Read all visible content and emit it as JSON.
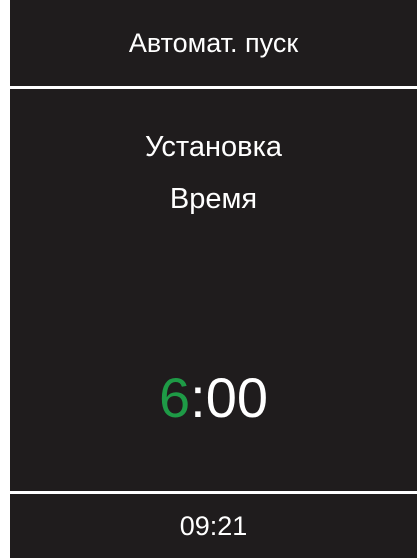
{
  "header": {
    "title": "Автомат. пуск"
  },
  "main": {
    "subtitle_line1": "Установка",
    "subtitle_line2": "Время",
    "time_value": {
      "hour": "6",
      "rest": ":00"
    }
  },
  "footer": {
    "clock": "09:21"
  },
  "colors": {
    "background": "#1f1c1d",
    "text": "#ffffff",
    "active_digit": "#1e9a46"
  }
}
